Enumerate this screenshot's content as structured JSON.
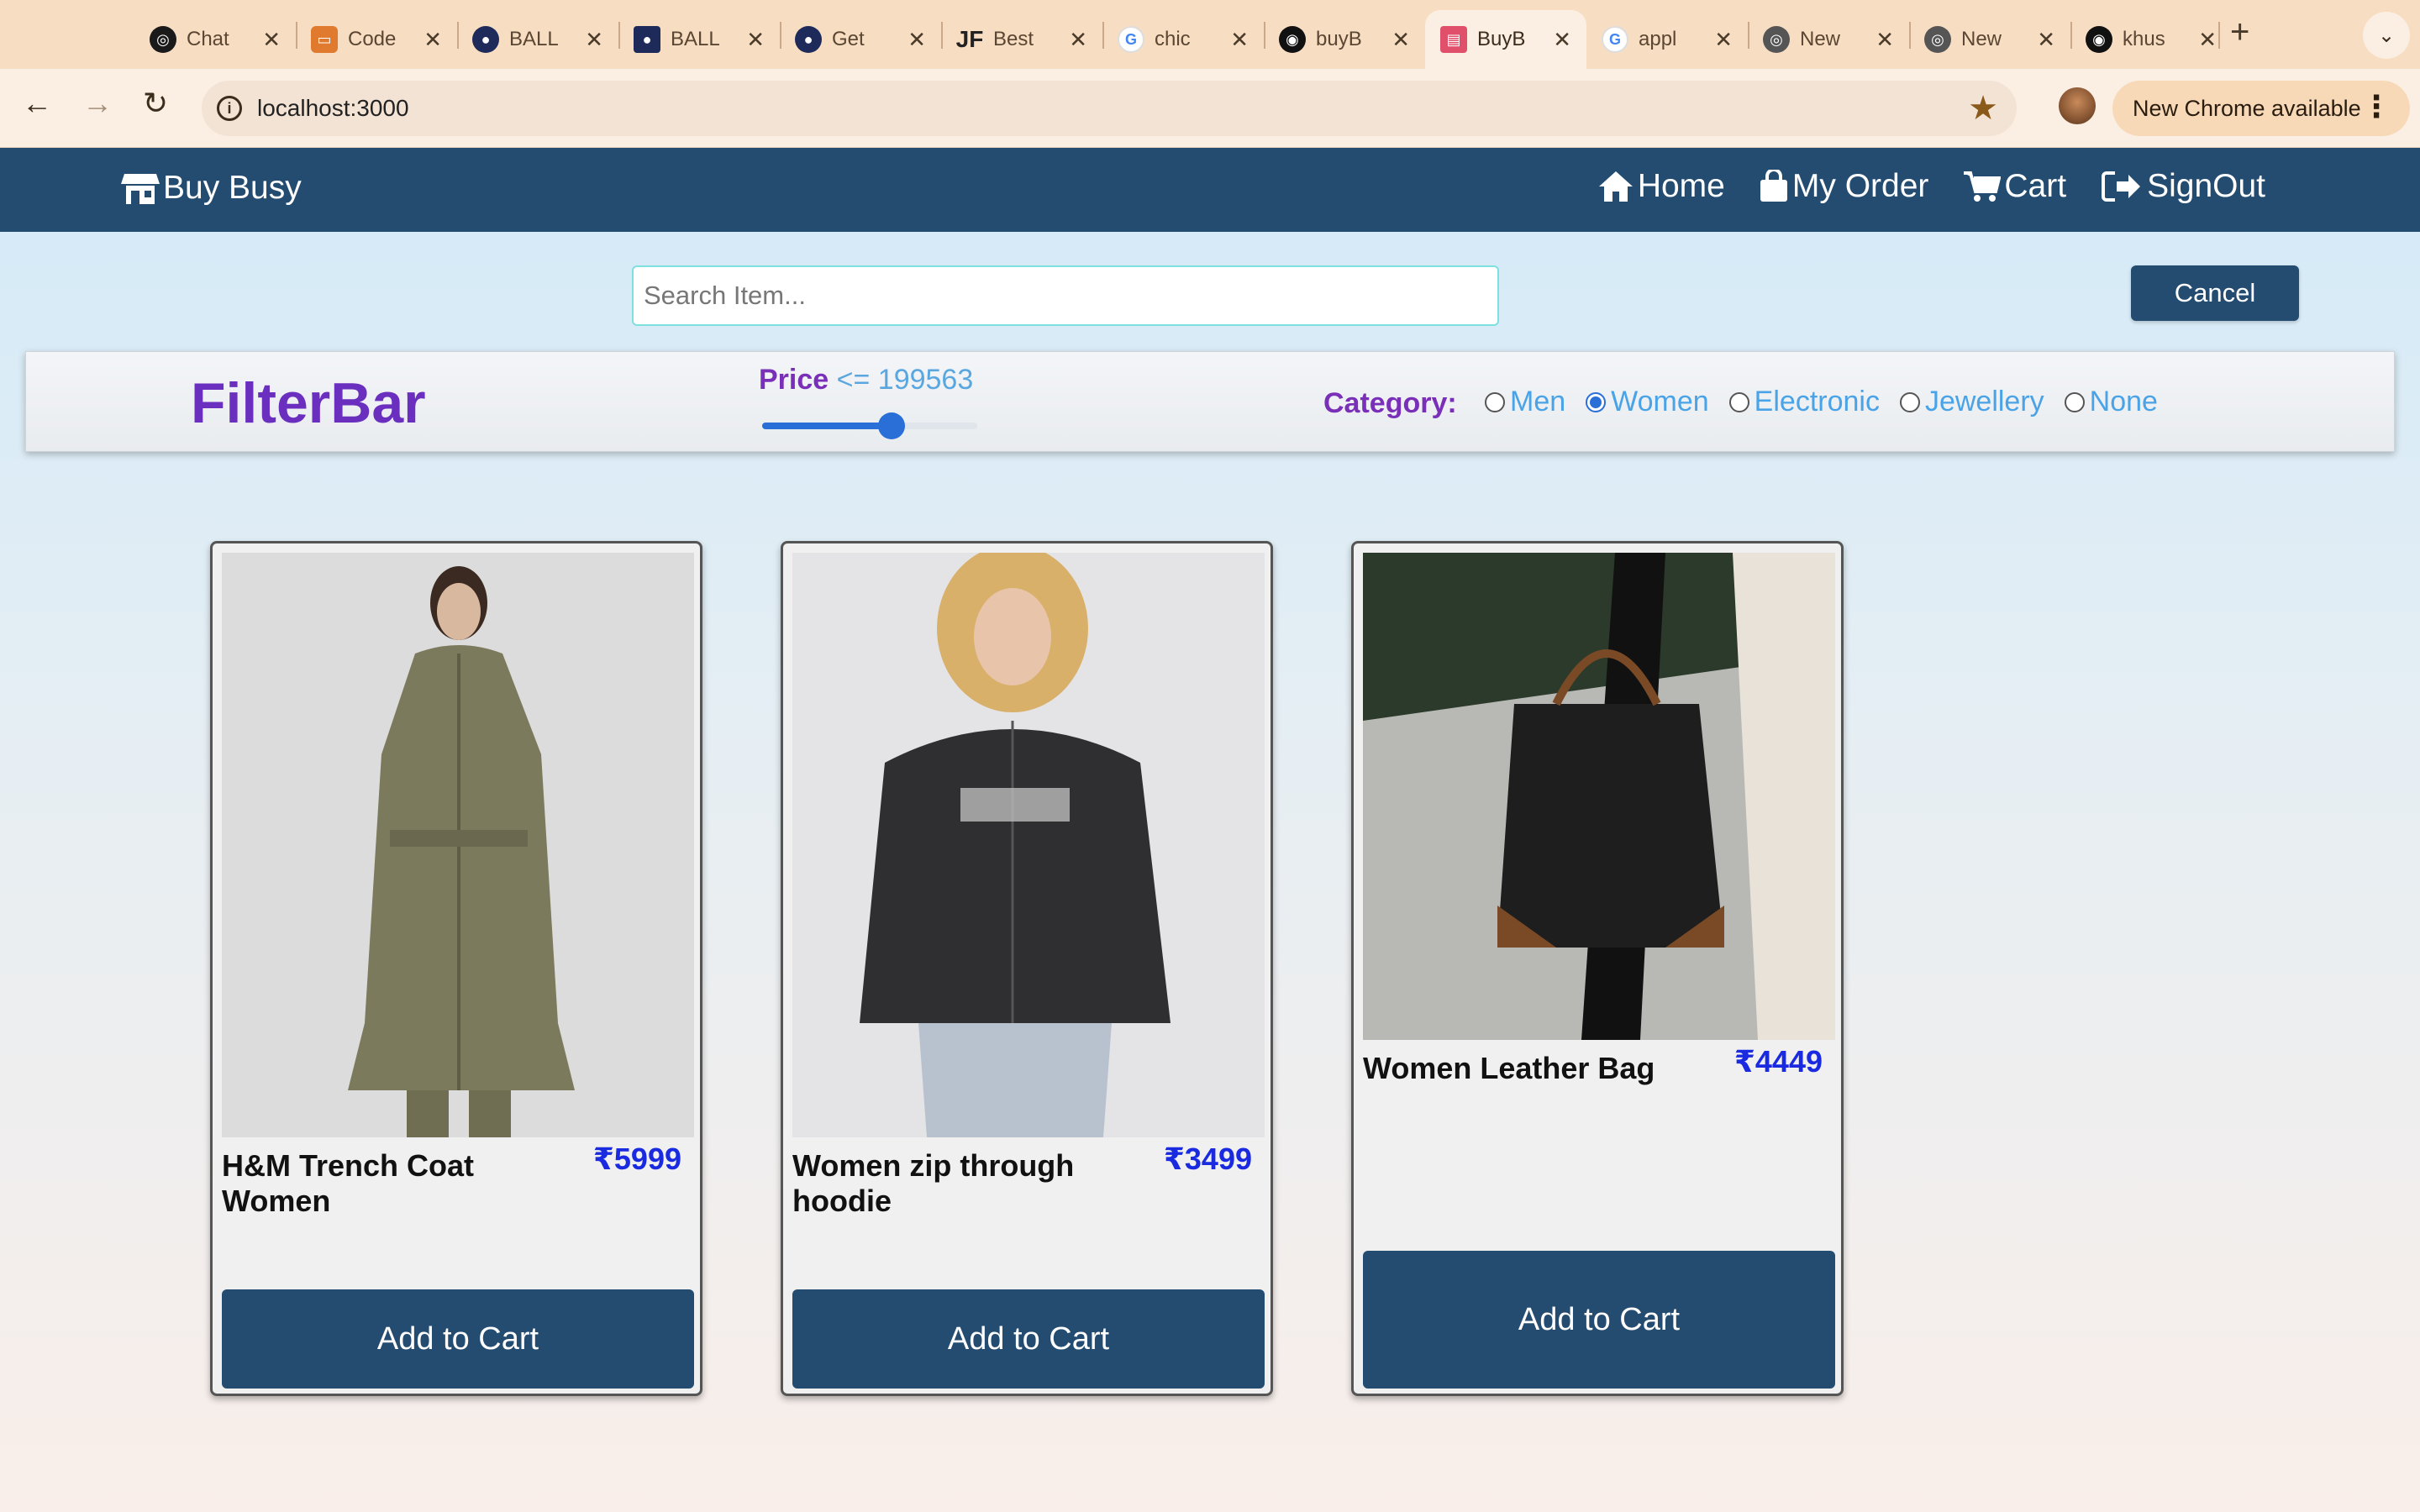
{
  "browser": {
    "tabs": [
      {
        "label": "Chat",
        "icon": "openai-icon",
        "color": "#1a1a1a"
      },
      {
        "label": "Code",
        "icon": "codeium-icon",
        "color": "#e07a2e"
      },
      {
        "label": "BALL",
        "icon": "ball-logo-icon",
        "color": "#1e2a5a"
      },
      {
        "label": "BALL",
        "icon": "ball-logo-icon",
        "color": "#1e2a5a"
      },
      {
        "label": "Get",
        "icon": "ball-logo-icon",
        "color": "#1e2a5a"
      },
      {
        "label": "Best",
        "icon": "jf-icon",
        "color": "#222222"
      },
      {
        "label": "chic",
        "icon": "google-icon",
        "color": "#4285f4"
      },
      {
        "label": "buyB",
        "icon": "github-icon",
        "color": "#111111"
      },
      {
        "label": "BuyB",
        "icon": "shop-icon",
        "color": "#e0506a"
      },
      {
        "label": "appl",
        "icon": "google-icon",
        "color": "#4285f4"
      },
      {
        "label": "New",
        "icon": "chrome-icon",
        "color": "#555555"
      },
      {
        "label": "New",
        "icon": "chrome-icon",
        "color": "#555555"
      },
      {
        "label": "khus",
        "icon": "github-icon",
        "color": "#111111"
      }
    ],
    "active_tab": 8,
    "url": "localhost:3000",
    "update_label": "New Chrome available"
  },
  "nav": {
    "brand": "Buy Busy",
    "links": [
      {
        "label": "Home",
        "icon": "home-icon"
      },
      {
        "label": "My Order",
        "icon": "shopping-bag-icon"
      },
      {
        "label": "Cart",
        "icon": "cart-icon"
      },
      {
        "label": "SignOut",
        "icon": "sign-out-icon"
      }
    ]
  },
  "search": {
    "placeholder": "Search Item...",
    "value": "",
    "cancel_label": "Cancel"
  },
  "filter": {
    "title": "FilterBar",
    "price_label": "Price",
    "price_value": "<= 199563",
    "price_fraction": 0.6,
    "category_label": "Category:",
    "categories": [
      "Men",
      "Women",
      "Electronic",
      "Jewellery",
      "None"
    ],
    "selected_category": "Women"
  },
  "products": [
    {
      "name": "H&M Trench Coat Women",
      "price": "₹5999",
      "add_label": "Add to Cart",
      "image": "trench-coat-image"
    },
    {
      "name": "Women zip through hoodie",
      "price": "₹3499",
      "add_label": "Add to Cart",
      "image": "hoodie-image"
    },
    {
      "name": "Women Leather Bag",
      "price": "₹4449",
      "add_label": "Add to Cart",
      "image": "leather-bag-image"
    }
  ],
  "colors": {
    "navbar": "#244b70",
    "accent_purple": "#6a2fbf",
    "link_blue": "#4aa3e6",
    "price_blue": "#1a2ae0"
  }
}
